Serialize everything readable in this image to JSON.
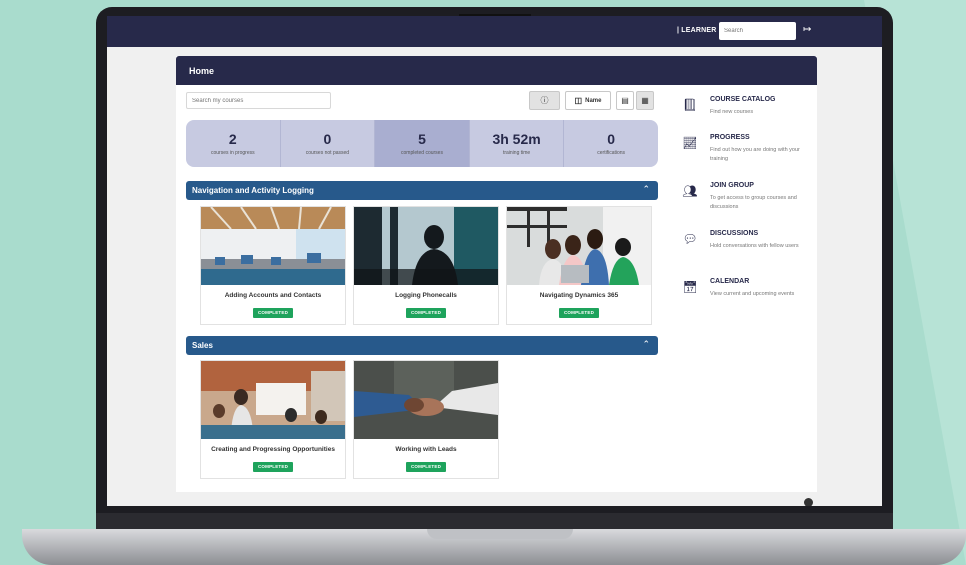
{
  "topbar": {
    "role_label": "| LEARNER",
    "search_placeholder": "Search",
    "logout_icon": "sign-out-icon"
  },
  "page": {
    "title": "Home"
  },
  "toolbar": {
    "search_placeholder": "Search my courses",
    "info_icon": "info-icon",
    "sort_label": "Name",
    "sort_icon": "database-icon",
    "list_icon": "list-view-icon",
    "grid_icon": "grid-view-icon"
  },
  "stats": [
    {
      "value": "2",
      "label": "courses in progress"
    },
    {
      "value": "0",
      "label": "courses not passed"
    },
    {
      "value": "5",
      "label": "completed courses"
    },
    {
      "value": "3h 52m",
      "label": "training time"
    },
    {
      "value": "0",
      "label": "certifications"
    }
  ],
  "sections": [
    {
      "title": "Navigation and Activity Logging",
      "courses": [
        {
          "title": "Adding Accounts and Contacts",
          "status": "COMPLETED"
        },
        {
          "title": "Logging Phonecalls",
          "status": "COMPLETED"
        },
        {
          "title": "Navigating Dynamics 365",
          "status": "COMPLETED"
        }
      ]
    },
    {
      "title": "Sales",
      "courses": [
        {
          "title": "Creating and Progressing Opportunities",
          "status": "COMPLETED"
        },
        {
          "title": "Working with Leads",
          "status": "COMPLETED"
        }
      ]
    }
  ],
  "menu": [
    {
      "title": "COURSE CATALOG",
      "desc": "Find new courses",
      "icon": "book-icon"
    },
    {
      "title": "PROGRESS",
      "desc": "Find out how you are doing with your training",
      "icon": "progress-chart-icon"
    },
    {
      "title": "JOIN GROUP",
      "desc": "To get access to group courses and discussions",
      "icon": "group-icon"
    },
    {
      "title": "DISCUSSIONS",
      "desc": "Hold conversations with fellow users",
      "icon": "chat-icon"
    },
    {
      "title": "CALENDAR",
      "desc": "View current and upcoming events",
      "icon": "calendar-icon"
    }
  ],
  "colors": {
    "navy": "#27294a",
    "section_blue": "#27598b",
    "completed_green": "#1ea35c",
    "stats_bg": "#c7cae1",
    "page_bg": "#a9dccd"
  }
}
